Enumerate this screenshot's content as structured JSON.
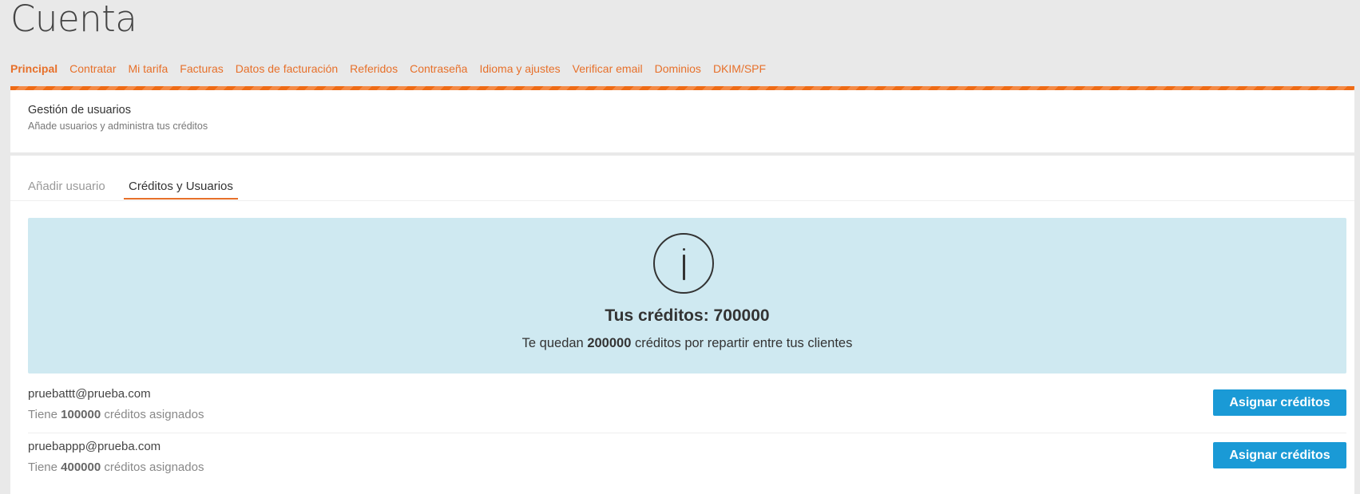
{
  "page": {
    "title": "Cuenta"
  },
  "nav": {
    "items": [
      {
        "label": "Principal"
      },
      {
        "label": "Contratar"
      },
      {
        "label": "Mi tarifa"
      },
      {
        "label": "Facturas"
      },
      {
        "label": "Datos de facturación"
      },
      {
        "label": "Referidos"
      },
      {
        "label": "Contraseña"
      },
      {
        "label": "Idioma y ajustes"
      },
      {
        "label": "Verificar email"
      },
      {
        "label": "Dominios"
      },
      {
        "label": "DKIM/SPF"
      }
    ],
    "active": "Principal"
  },
  "section": {
    "title": "Gestión de usuarios",
    "subtitle": "Añade usuarios y administra tus créditos"
  },
  "tabs": [
    {
      "label": "Añadir usuario"
    },
    {
      "label": "Créditos y Usuarios"
    }
  ],
  "info": {
    "icon": "info-circle-icon",
    "title": "Tus créditos: 700000",
    "sub_prefix": "Te quedan ",
    "sub_amount": "200000",
    "sub_suffix": " créditos por repartir entre tus clientes"
  },
  "users": [
    {
      "email": "pruebattt@prueba.com",
      "prefix": "Tiene ",
      "amount": "100000",
      "suffix": " créditos asignados",
      "button": "Asignar créditos"
    },
    {
      "email": "pruebappp@prueba.com",
      "prefix": "Tiene ",
      "amount": "400000",
      "suffix": " créditos asignados",
      "button": "Asignar créditos"
    }
  ],
  "colors": {
    "accent": "#e7702a",
    "info_bg": "#cfe9f1",
    "button": "#1a9ad6",
    "background": "#e9e9e9"
  }
}
